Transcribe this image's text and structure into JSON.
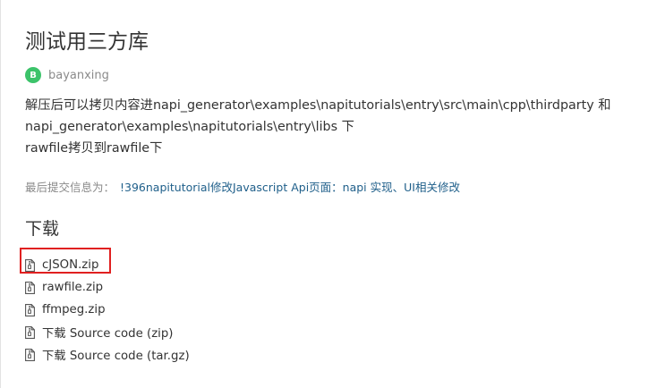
{
  "release": {
    "title": "测试用三方库",
    "author_initial": "B",
    "author": "bayanxing",
    "description_lines": [
      "解压后可以拷贝内容进napi_generator\\examples\\napitutorials\\entry\\src\\main\\cpp\\thirdparty 和",
      "napi_generator\\examples\\napitutorials\\entry\\libs 下",
      "rawfile拷贝到rawfile下"
    ],
    "commit_label": "最后提交信息为：",
    "commit_message": "!396napitutorial修改Javascript Api页面：napi 实现、UI相关修改"
  },
  "downloads": {
    "heading": "下载",
    "files": [
      {
        "name": "cJSON.zip",
        "icon": "zip-file-icon",
        "highlighted": true
      },
      {
        "name": "rawfile.zip",
        "icon": "zip-file-icon"
      },
      {
        "name": "ffmpeg.zip",
        "icon": "zip-file-icon"
      },
      {
        "name": "下载 Source code (zip)",
        "icon": "zip-file-icon"
      },
      {
        "name": "下载 Source code (tar.gz)",
        "icon": "zip-file-icon"
      }
    ]
  },
  "colors": {
    "avatar_bg": "#3cc36a",
    "link": "#1f5f8a",
    "highlight": "#e02020"
  }
}
